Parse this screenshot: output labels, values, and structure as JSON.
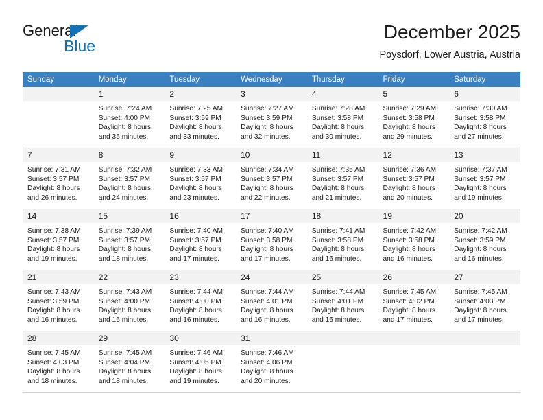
{
  "logo": {
    "text_primary": "General",
    "text_secondary": "Blue",
    "triangle_color": "#1172b8",
    "primary_color": "#1b1b1b",
    "secondary_color": "#1172b8"
  },
  "header": {
    "title": "December 2025",
    "subtitle": "Poysdorf, Lower Austria, Austria"
  },
  "calendar": {
    "header_background": "#3a7fbf",
    "header_text_color": "#ffffff",
    "daynum_band_color": "#f2f2f2",
    "weekday_headers": [
      "Sunday",
      "Monday",
      "Tuesday",
      "Wednesday",
      "Thursday",
      "Friday",
      "Saturday"
    ],
    "weeks": [
      [
        {
          "day": "",
          "lines": []
        },
        {
          "day": "1",
          "lines": [
            "Sunrise: 7:24 AM",
            "Sunset: 4:00 PM",
            "Daylight: 8 hours",
            "and 35 minutes."
          ]
        },
        {
          "day": "2",
          "lines": [
            "Sunrise: 7:25 AM",
            "Sunset: 3:59 PM",
            "Daylight: 8 hours",
            "and 33 minutes."
          ]
        },
        {
          "day": "3",
          "lines": [
            "Sunrise: 7:27 AM",
            "Sunset: 3:59 PM",
            "Daylight: 8 hours",
            "and 32 minutes."
          ]
        },
        {
          "day": "4",
          "lines": [
            "Sunrise: 7:28 AM",
            "Sunset: 3:58 PM",
            "Daylight: 8 hours",
            "and 30 minutes."
          ]
        },
        {
          "day": "5",
          "lines": [
            "Sunrise: 7:29 AM",
            "Sunset: 3:58 PM",
            "Daylight: 8 hours",
            "and 29 minutes."
          ]
        },
        {
          "day": "6",
          "lines": [
            "Sunrise: 7:30 AM",
            "Sunset: 3:58 PM",
            "Daylight: 8 hours",
            "and 27 minutes."
          ]
        }
      ],
      [
        {
          "day": "7",
          "lines": [
            "Sunrise: 7:31 AM",
            "Sunset: 3:57 PM",
            "Daylight: 8 hours",
            "and 26 minutes."
          ]
        },
        {
          "day": "8",
          "lines": [
            "Sunrise: 7:32 AM",
            "Sunset: 3:57 PM",
            "Daylight: 8 hours",
            "and 24 minutes."
          ]
        },
        {
          "day": "9",
          "lines": [
            "Sunrise: 7:33 AM",
            "Sunset: 3:57 PM",
            "Daylight: 8 hours",
            "and 23 minutes."
          ]
        },
        {
          "day": "10",
          "lines": [
            "Sunrise: 7:34 AM",
            "Sunset: 3:57 PM",
            "Daylight: 8 hours",
            "and 22 minutes."
          ]
        },
        {
          "day": "11",
          "lines": [
            "Sunrise: 7:35 AM",
            "Sunset: 3:57 PM",
            "Daylight: 8 hours",
            "and 21 minutes."
          ]
        },
        {
          "day": "12",
          "lines": [
            "Sunrise: 7:36 AM",
            "Sunset: 3:57 PM",
            "Daylight: 8 hours",
            "and 20 minutes."
          ]
        },
        {
          "day": "13",
          "lines": [
            "Sunrise: 7:37 AM",
            "Sunset: 3:57 PM",
            "Daylight: 8 hours",
            "and 19 minutes."
          ]
        }
      ],
      [
        {
          "day": "14",
          "lines": [
            "Sunrise: 7:38 AM",
            "Sunset: 3:57 PM",
            "Daylight: 8 hours",
            "and 19 minutes."
          ]
        },
        {
          "day": "15",
          "lines": [
            "Sunrise: 7:39 AM",
            "Sunset: 3:57 PM",
            "Daylight: 8 hours",
            "and 18 minutes."
          ]
        },
        {
          "day": "16",
          "lines": [
            "Sunrise: 7:40 AM",
            "Sunset: 3:57 PM",
            "Daylight: 8 hours",
            "and 17 minutes."
          ]
        },
        {
          "day": "17",
          "lines": [
            "Sunrise: 7:40 AM",
            "Sunset: 3:58 PM",
            "Daylight: 8 hours",
            "and 17 minutes."
          ]
        },
        {
          "day": "18",
          "lines": [
            "Sunrise: 7:41 AM",
            "Sunset: 3:58 PM",
            "Daylight: 8 hours",
            "and 16 minutes."
          ]
        },
        {
          "day": "19",
          "lines": [
            "Sunrise: 7:42 AM",
            "Sunset: 3:58 PM",
            "Daylight: 8 hours",
            "and 16 minutes."
          ]
        },
        {
          "day": "20",
          "lines": [
            "Sunrise: 7:42 AM",
            "Sunset: 3:59 PM",
            "Daylight: 8 hours",
            "and 16 minutes."
          ]
        }
      ],
      [
        {
          "day": "21",
          "lines": [
            "Sunrise: 7:43 AM",
            "Sunset: 3:59 PM",
            "Daylight: 8 hours",
            "and 16 minutes."
          ]
        },
        {
          "day": "22",
          "lines": [
            "Sunrise: 7:43 AM",
            "Sunset: 4:00 PM",
            "Daylight: 8 hours",
            "and 16 minutes."
          ]
        },
        {
          "day": "23",
          "lines": [
            "Sunrise: 7:44 AM",
            "Sunset: 4:00 PM",
            "Daylight: 8 hours",
            "and 16 minutes."
          ]
        },
        {
          "day": "24",
          "lines": [
            "Sunrise: 7:44 AM",
            "Sunset: 4:01 PM",
            "Daylight: 8 hours",
            "and 16 minutes."
          ]
        },
        {
          "day": "25",
          "lines": [
            "Sunrise: 7:44 AM",
            "Sunset: 4:01 PM",
            "Daylight: 8 hours",
            "and 16 minutes."
          ]
        },
        {
          "day": "26",
          "lines": [
            "Sunrise: 7:45 AM",
            "Sunset: 4:02 PM",
            "Daylight: 8 hours",
            "and 17 minutes."
          ]
        },
        {
          "day": "27",
          "lines": [
            "Sunrise: 7:45 AM",
            "Sunset: 4:03 PM",
            "Daylight: 8 hours",
            "and 17 minutes."
          ]
        }
      ],
      [
        {
          "day": "28",
          "lines": [
            "Sunrise: 7:45 AM",
            "Sunset: 4:03 PM",
            "Daylight: 8 hours",
            "and 18 minutes."
          ]
        },
        {
          "day": "29",
          "lines": [
            "Sunrise: 7:45 AM",
            "Sunset: 4:04 PM",
            "Daylight: 8 hours",
            "and 18 minutes."
          ]
        },
        {
          "day": "30",
          "lines": [
            "Sunrise: 7:46 AM",
            "Sunset: 4:05 PM",
            "Daylight: 8 hours",
            "and 19 minutes."
          ]
        },
        {
          "day": "31",
          "lines": [
            "Sunrise: 7:46 AM",
            "Sunset: 4:06 PM",
            "Daylight: 8 hours",
            "and 20 minutes."
          ]
        },
        {
          "day": "",
          "lines": []
        },
        {
          "day": "",
          "lines": []
        },
        {
          "day": "",
          "lines": []
        }
      ]
    ]
  }
}
